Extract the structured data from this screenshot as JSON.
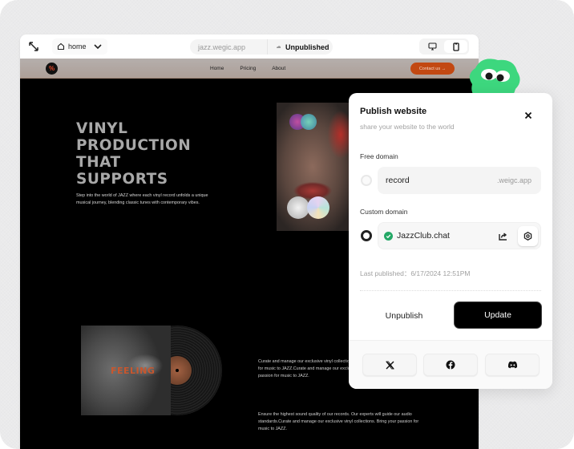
{
  "toolbar": {
    "page_selector": "home",
    "url": "jazz.wegic.app",
    "status": "Unpublished",
    "devices": [
      {
        "name": "desktop",
        "active": false
      },
      {
        "name": "mobile",
        "active": true
      }
    ]
  },
  "site": {
    "logo_text": "%",
    "nav_links": [
      "Home",
      "Pricing",
      "About"
    ],
    "contact_button": "Contact us →",
    "hero_title_lines": [
      "VINYL",
      "PRODUCTION",
      "THAT",
      "SUPPORTS"
    ],
    "hero_subtitle": "Step into the world of JAZZ where each vinyl record unfolds a unique musical journey, blending classic tunes with contemporary vibes.",
    "album_title": "FEELING",
    "feature_1": "Curate and manage our exclusive vinyl collections. Bring your passion for music to JAZZ.Curate and manage our exclusive vinyl. Bring your passion for music to JAZZ.",
    "feature_2": "Ensure the highest sound quality of our records. Our experts will guide our audio standards.Curate and manage our exclusive vinyl collections. Bring your passion for music to JAZZ."
  },
  "publish": {
    "title": "Publish website",
    "subtitle": "share your website to the world",
    "free_domain_label": "Free domain",
    "free_domain_value": "record",
    "free_domain_suffix": ".weigc.app",
    "custom_domain_label": "Custom domain",
    "custom_domain_value": "JazzClub.chat",
    "custom_domain_verified": true,
    "selected_option": "custom",
    "last_published": "Last published：6/17/2024  12:51PM",
    "unpublish_button": "Unpublish",
    "update_button": "Update",
    "share_targets": [
      "x-twitter",
      "facebook",
      "discord"
    ]
  },
  "colors": {
    "accent_orange": "#c24812",
    "verified_green": "#24a866",
    "mascot_green": "#3dd77e"
  }
}
